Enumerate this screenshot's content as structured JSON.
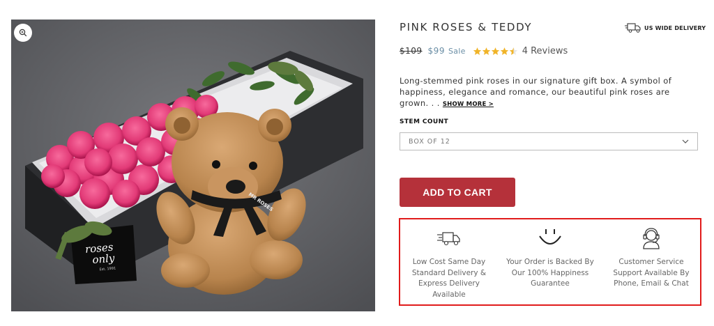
{
  "product": {
    "title": "PINK ROSES & TEDDY",
    "old_price": "$109",
    "new_price": "$99",
    "sale_label": "Sale",
    "rating": 4.5,
    "reviews": "4 Reviews",
    "description": "Long-stemmed pink roses in our signature gift box. A symbol of happiness, elegance and romance, our beautiful pink roses are grown. . .",
    "show_more": "SHOW MORE >"
  },
  "delivery": {
    "label": "US WIDE DELIVERY",
    "icon": "delivery-truck-icon"
  },
  "stem": {
    "label": "STEM COUNT",
    "selected": "BOX OF 12"
  },
  "cart": {
    "label": "ADD TO CART"
  },
  "features": [
    {
      "icon": "fast-delivery-truck-icon",
      "text": "Low Cost Same Day Standard Delivery & Express Delivery Available"
    },
    {
      "icon": "smiley-face-icon",
      "text": "Your Order is Backed By Our 100% Happiness Guarantee"
    },
    {
      "icon": "headset-support-icon",
      "text": "Customer Service Support Available By Phone, Email & Chat"
    }
  ],
  "image": {
    "box_logo_line1": "roses",
    "box_logo_line2": "only",
    "box_logo_est": "Est. 1991",
    "ribbon_text": "MR ROSES"
  },
  "colors": {
    "accent_button": "#b5313a",
    "sale_price": "#6a8ea5",
    "stars": "#f0b429",
    "highlight_border": "#e11b1b"
  }
}
